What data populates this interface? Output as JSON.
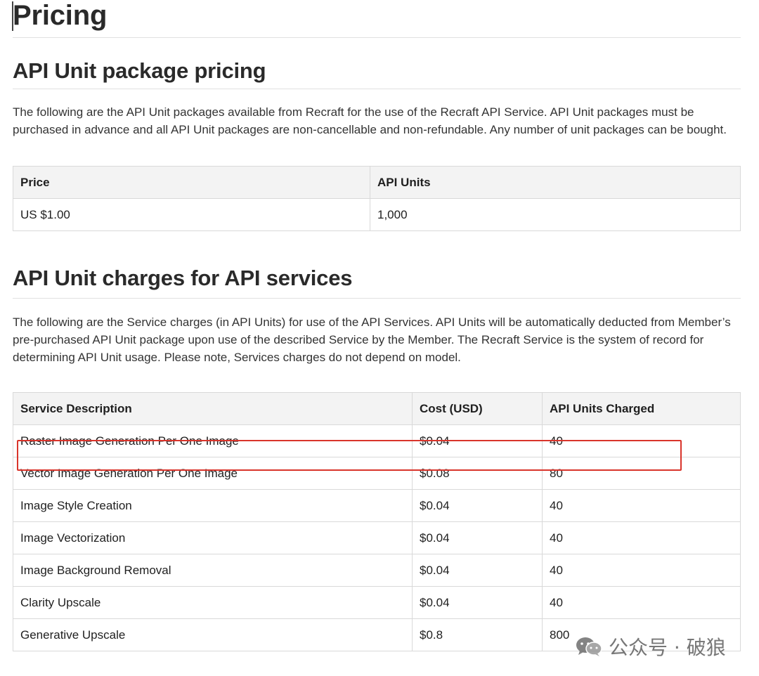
{
  "page_title": "Pricing",
  "package_section": {
    "heading": "API Unit package pricing",
    "description": "The following are the API Unit packages available from Recraft for the use of the Recraft API Service. API Unit packages must be purchased in advance and all API Unit packages are non-cancellable and non-refundable. Any number of unit packages can be bought.",
    "table": {
      "headers": [
        "Price",
        "API Units"
      ],
      "rows": [
        [
          "US $1.00",
          "1,000"
        ]
      ]
    }
  },
  "charges_section": {
    "heading": "API Unit charges for API services",
    "description": "The following are the Service charges (in API Units) for use of the API Services. API Units will be automatically deducted from Member’s pre-purchased API Unit package upon use of the described Service by the Member. The Recraft Service is the system of record for determining API Unit usage. Please note, Services charges do not depend on model.",
    "table": {
      "headers": [
        "Service Description",
        "Cost (USD)",
        "API Units Charged"
      ],
      "rows": [
        [
          "Raster Image Generation Per One Image",
          "$0.04",
          "40"
        ],
        [
          "Vector Image Generation Per One Image",
          "$0.08",
          "80"
        ],
        [
          "Image Style Creation",
          "$0.04",
          "40"
        ],
        [
          "Image Vectorization",
          "$0.04",
          "40"
        ],
        [
          "Image Background Removal",
          "$0.04",
          "40"
        ],
        [
          "Clarity Upscale",
          "$0.04",
          "40"
        ],
        [
          "Generative Upscale",
          "$0.8",
          "800"
        ]
      ]
    },
    "highlight_color": "#d9342b"
  },
  "watermark": {
    "icon": "wechat-icon",
    "text": "公众号 · 破狼"
  }
}
